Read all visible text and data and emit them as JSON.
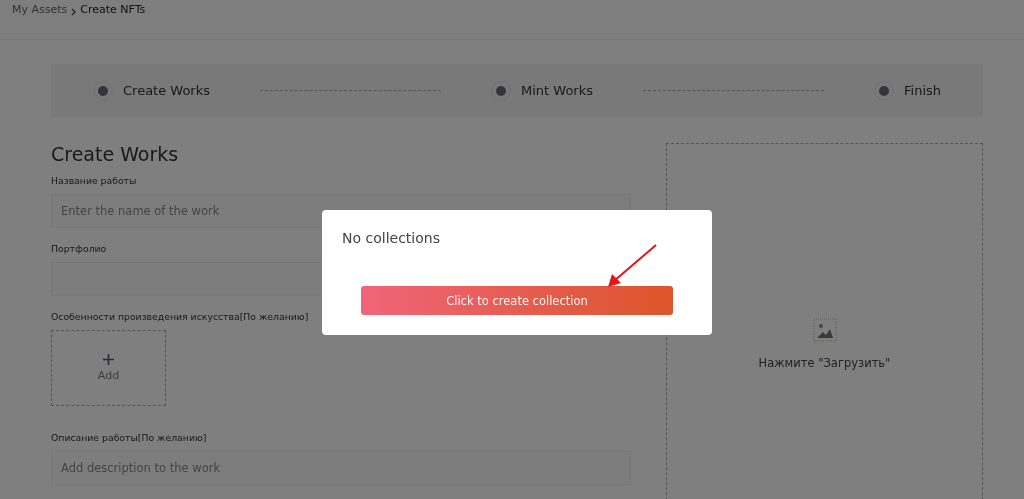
{
  "breadcrumb": [
    {
      "label": "My Assets",
      "current": false
    },
    {
      "label": "Create NFTs",
      "current": true
    }
  ],
  "steps": [
    {
      "label": "Create Works"
    },
    {
      "label": "Mint Works"
    },
    {
      "label": "Finish"
    }
  ],
  "form": {
    "title": "Create Works",
    "fields": [
      {
        "kind": "input",
        "label": "Название работы",
        "placeholder": "Enter the name of the work"
      },
      {
        "kind": "input",
        "label": "Портфолио"
      },
      {
        "kind": "add",
        "label": "Особенности произведения искусства[По желанию]",
        "button": "Add"
      },
      {
        "kind": "input",
        "label": "Описание работы[По желанию]",
        "placeholder": "Add description to the work"
      }
    ]
  },
  "upload": {
    "hint": "Нажмите \"Загрузить\""
  },
  "dialog": {
    "message": "No collections",
    "button": "Click to create collection"
  }
}
